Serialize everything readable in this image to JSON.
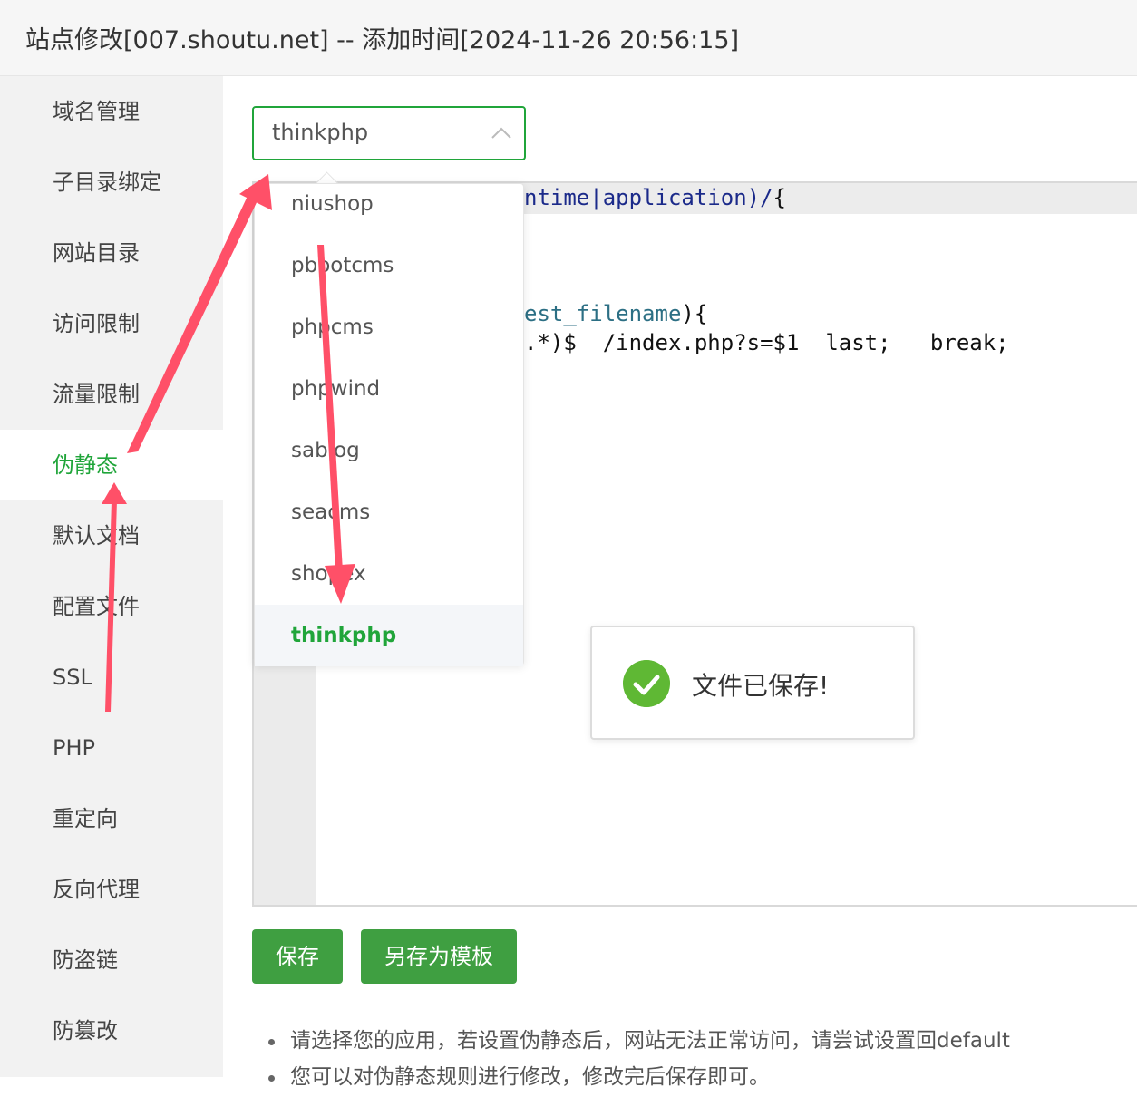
{
  "window": {
    "title": "站点修改[007.shoutu.net] -- 添加时间[2024-11-26 20:56:15]"
  },
  "sidebar": {
    "items": [
      {
        "label": "域名管理"
      },
      {
        "label": "子目录绑定"
      },
      {
        "label": "网站目录"
      },
      {
        "label": "访问限制"
      },
      {
        "label": "流量限制"
      },
      {
        "label": "伪静态",
        "active": true
      },
      {
        "label": "默认文档"
      },
      {
        "label": "配置文件"
      },
      {
        "label": "SSL"
      },
      {
        "label": "PHP"
      },
      {
        "label": "重定向"
      },
      {
        "label": "反向代理"
      },
      {
        "label": "防盗链"
      },
      {
        "label": "防篡改"
      }
    ]
  },
  "rewrite_select": {
    "value": "thinkphp",
    "options": [
      {
        "label": "niushop"
      },
      {
        "label": "pbootcms"
      },
      {
        "label": "phpcms"
      },
      {
        "label": "phpwind"
      },
      {
        "label": "sablog"
      },
      {
        "label": "seacms"
      },
      {
        "label": "shopex"
      },
      {
        "label": "thinkphp",
        "selected": true
      }
    ]
  },
  "editor": {
    "line1_a": "ntime|",
    "line1_b": "application)/",
    "line1_c": "{",
    "line2_a": "est_filename",
    "line2_b": "){",
    "line3": ".*)$  /index.php?s=$1  last;   break;"
  },
  "toast": {
    "message": "文件已保存!"
  },
  "buttons": {
    "save": "保存",
    "save_as_template": "另存为模板"
  },
  "tips": [
    "请选择您的应用，若设置伪静态后，网站无法正常访问，请尝试设置回default",
    "您可以对伪静态规则进行修改，修改完后保存即可。"
  ],
  "colors": {
    "accent": "#20a53a",
    "button": "#3f9f41",
    "annotation_arrow": "#ff5068",
    "success": "#5fb834"
  }
}
